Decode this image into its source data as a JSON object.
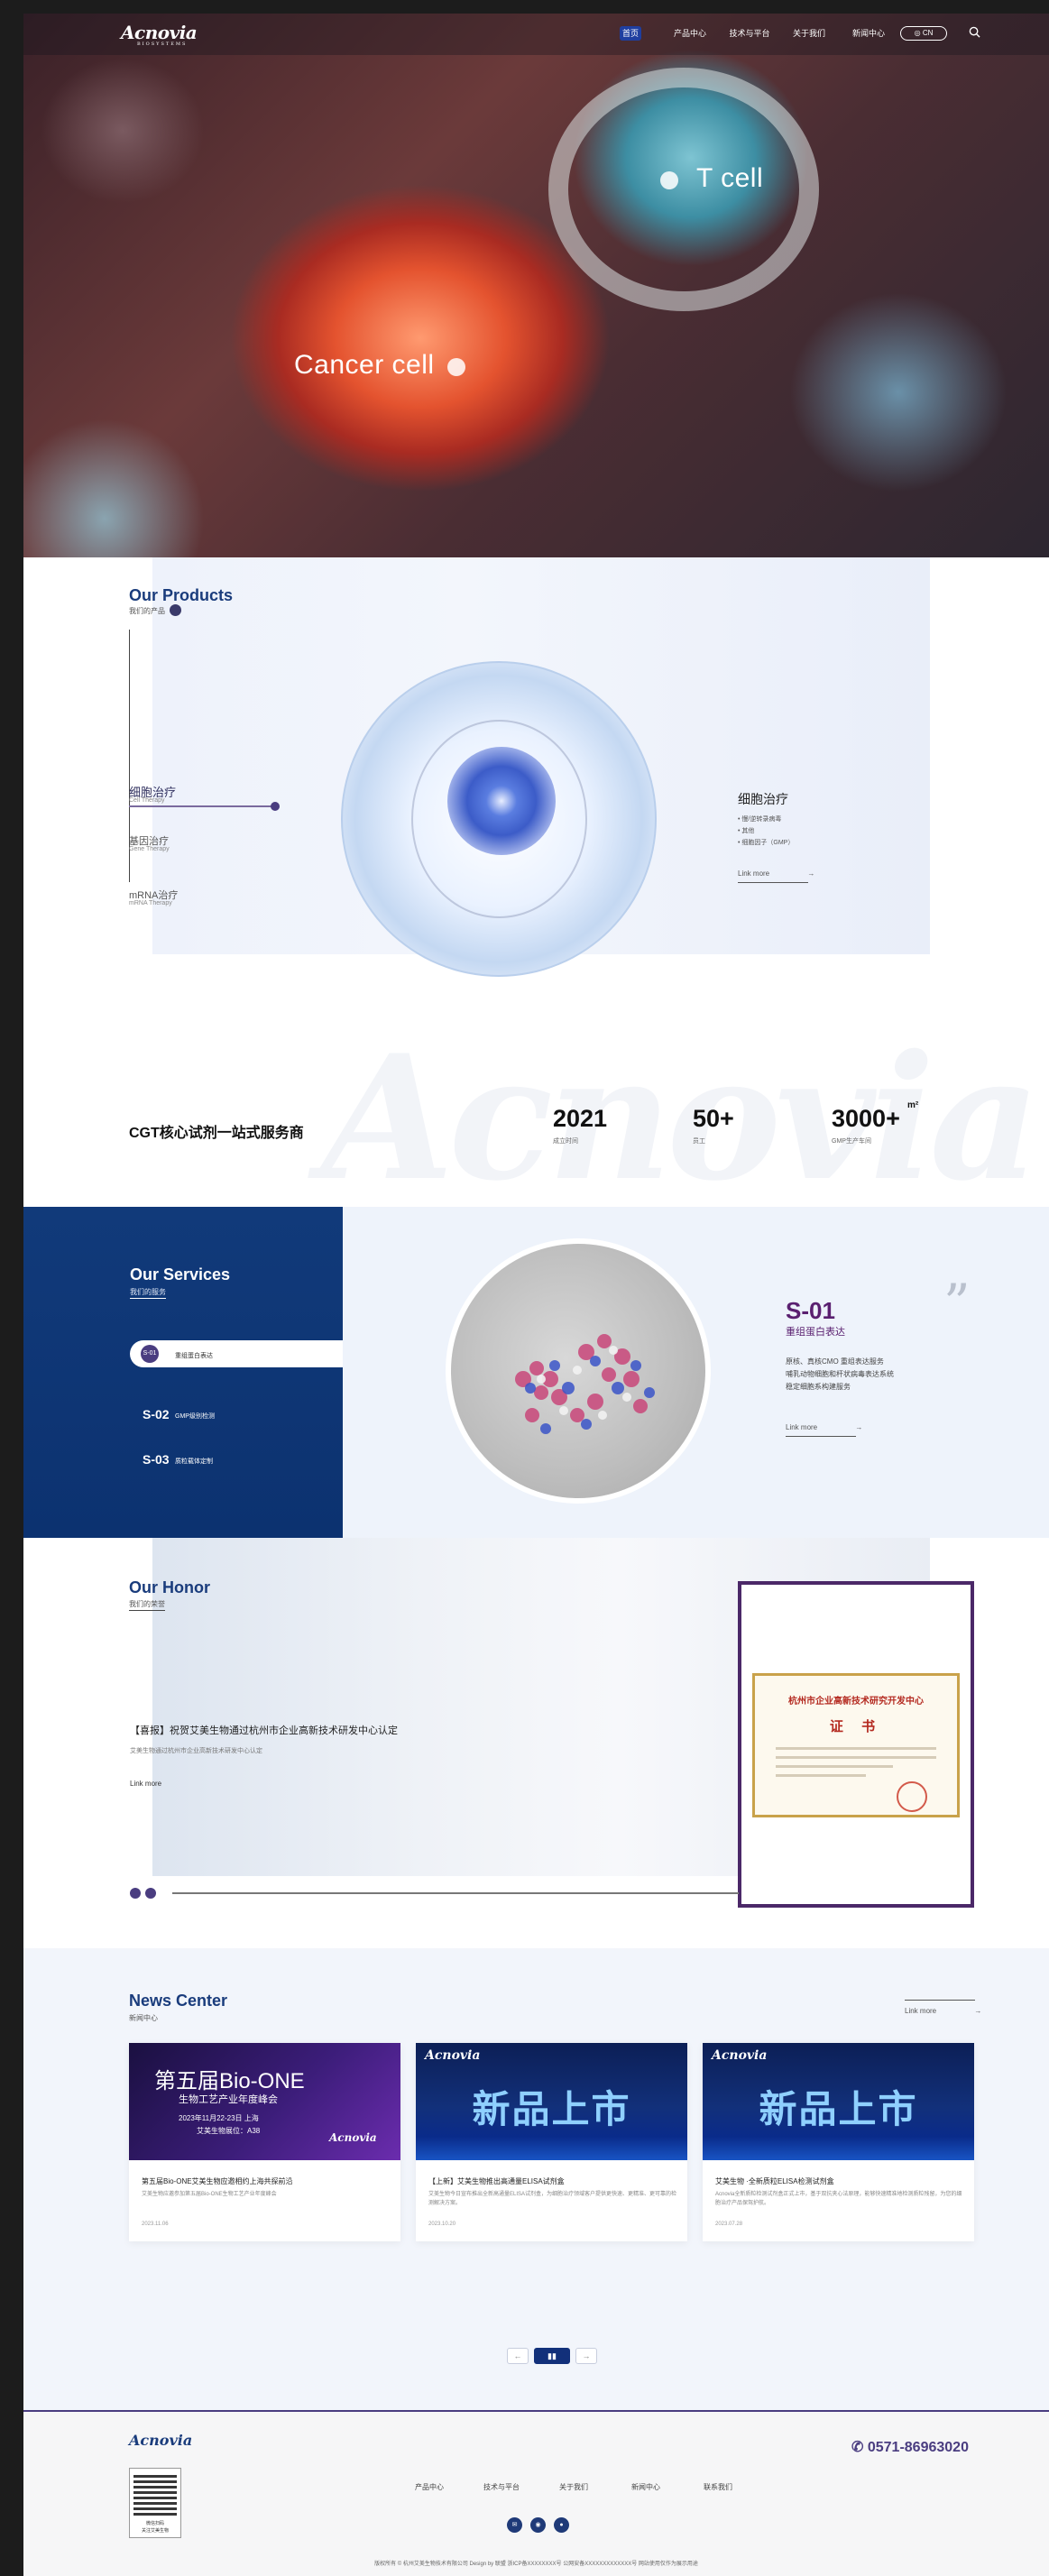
{
  "header": {
    "logo": "Acnovia",
    "logo_tagline": "BIOSYSTEMS",
    "nav": [
      "首页",
      "产品中心",
      "技术与平台",
      "关于我们",
      "新闻中心"
    ],
    "lang": "CN"
  },
  "hero": {
    "labels": [
      "T cell",
      "Cancer cell"
    ]
  },
  "products": {
    "title": "Our Products",
    "subtitle": "我们的产品",
    "tabs": [
      {
        "label": "细胞治疗",
        "sub": "Cell Therapy"
      },
      {
        "label": "基因治疗",
        "sub": "Gene Therapy"
      },
      {
        "label": "mRNA治疗",
        "sub": "mRNA Therapy"
      }
    ],
    "detail_title": "细胞治疗",
    "detail_items": [
      "• 慢/逆转录病毒",
      "• 其他",
      "• 细胞因子（GMP）"
    ],
    "more": "Link more"
  },
  "stats": {
    "watermark": "Acnovia",
    "title": "CGT核心试剂一站式服务商",
    "items": [
      {
        "value": "2021",
        "sup": "",
        "label": "成立时间"
      },
      {
        "value": "50+",
        "sup": "",
        "label": "员工"
      },
      {
        "value": "3000+",
        "sup": "m²",
        "label": "GMP生产车间"
      }
    ]
  },
  "services": {
    "title": "Our Services",
    "subtitle": "我们的服务",
    "items": [
      {
        "code": "S-01",
        "label": "重组蛋白表达"
      },
      {
        "code": "S-02",
        "label": "GMP级别检测"
      },
      {
        "code": "S-03",
        "label": "质粒载体定制"
      }
    ],
    "active_code": "S-01",
    "active_name": "重组蛋白表达",
    "desc": [
      "原核、真核CMO 重组表达服务",
      "哺乳动物细胞和杆状病毒表达系统",
      "稳定细胞系构建服务"
    ],
    "more": "Link more",
    "quote_mark": "”"
  },
  "honor": {
    "title": "Our Honor",
    "subtitle": "我们的荣誉",
    "headline": "【喜报】祝贺艾美生物通过杭州市企业高新技术研发中心认定",
    "text": "艾美生物通过杭州市企业高新技术研发中心认定",
    "more": "Link more",
    "cert_title": "杭州市企业高新技术研究开发中心",
    "cert_big": "证 书"
  },
  "news": {
    "title": "News Center",
    "subtitle": "新闻中心",
    "more": "Link more",
    "cards": [
      {
        "img_title": "第五届Bio-ONE",
        "img_sub": "生物工艺产业年度峰会",
        "img_date": "2023年11月22-23日 上海",
        "img_booth": "艾美生物展位：A38",
        "headline": "第五届Bio-ONE艾美生物应邀相约上海共探前沿",
        "desc": "艾美生物应邀参加第五届Bio-ONE生物工艺产业年度峰会",
        "date": "2023.11.06"
      },
      {
        "img_big": "新品上市",
        "headline": "【上新】艾美生物推出高通量ELISA试剂盒",
        "desc": "艾美生物今日宣布推出全新高通量ELISA试剂盒，为细胞治疗领域客户提供更快速、更精准、更可靠的检测解决方案。",
        "date": "2023.10.20"
      },
      {
        "img_big": "新品上市",
        "headline": "艾美生物 ·全新质粒ELISA检测试剂盒",
        "desc": "Acnovia全新质粒检测试剂盒正式上市，基于双抗夹心法原理，能够快速精准地检测质粒残留，为您的细胞治疗产品保驾护航。",
        "date": "2023.07.28"
      }
    ],
    "pager": {
      "prev": "←",
      "current": "▮▮",
      "next": "→"
    }
  },
  "footer": {
    "logo": "Acnovia",
    "qr_caption": [
      "微信扫码",
      "关注艾美生物"
    ],
    "phone": "0571-86963020",
    "links": [
      "产品中心",
      "技术与平台",
      "关于我们",
      "新闻中心",
      "联系我们"
    ],
    "copyright": "版权所有 © 杭州艾美生物技术有限公司 Design by 联盟 浙ICP备XXXXXXXX号 公网安备XXXXXXXXXXXXX号 网站使用仅作为展示用途"
  },
  "colors": {
    "brand_blue": "#12307a",
    "brand_purple": "#4a3d80",
    "accent_magenta": "#5a2070"
  }
}
